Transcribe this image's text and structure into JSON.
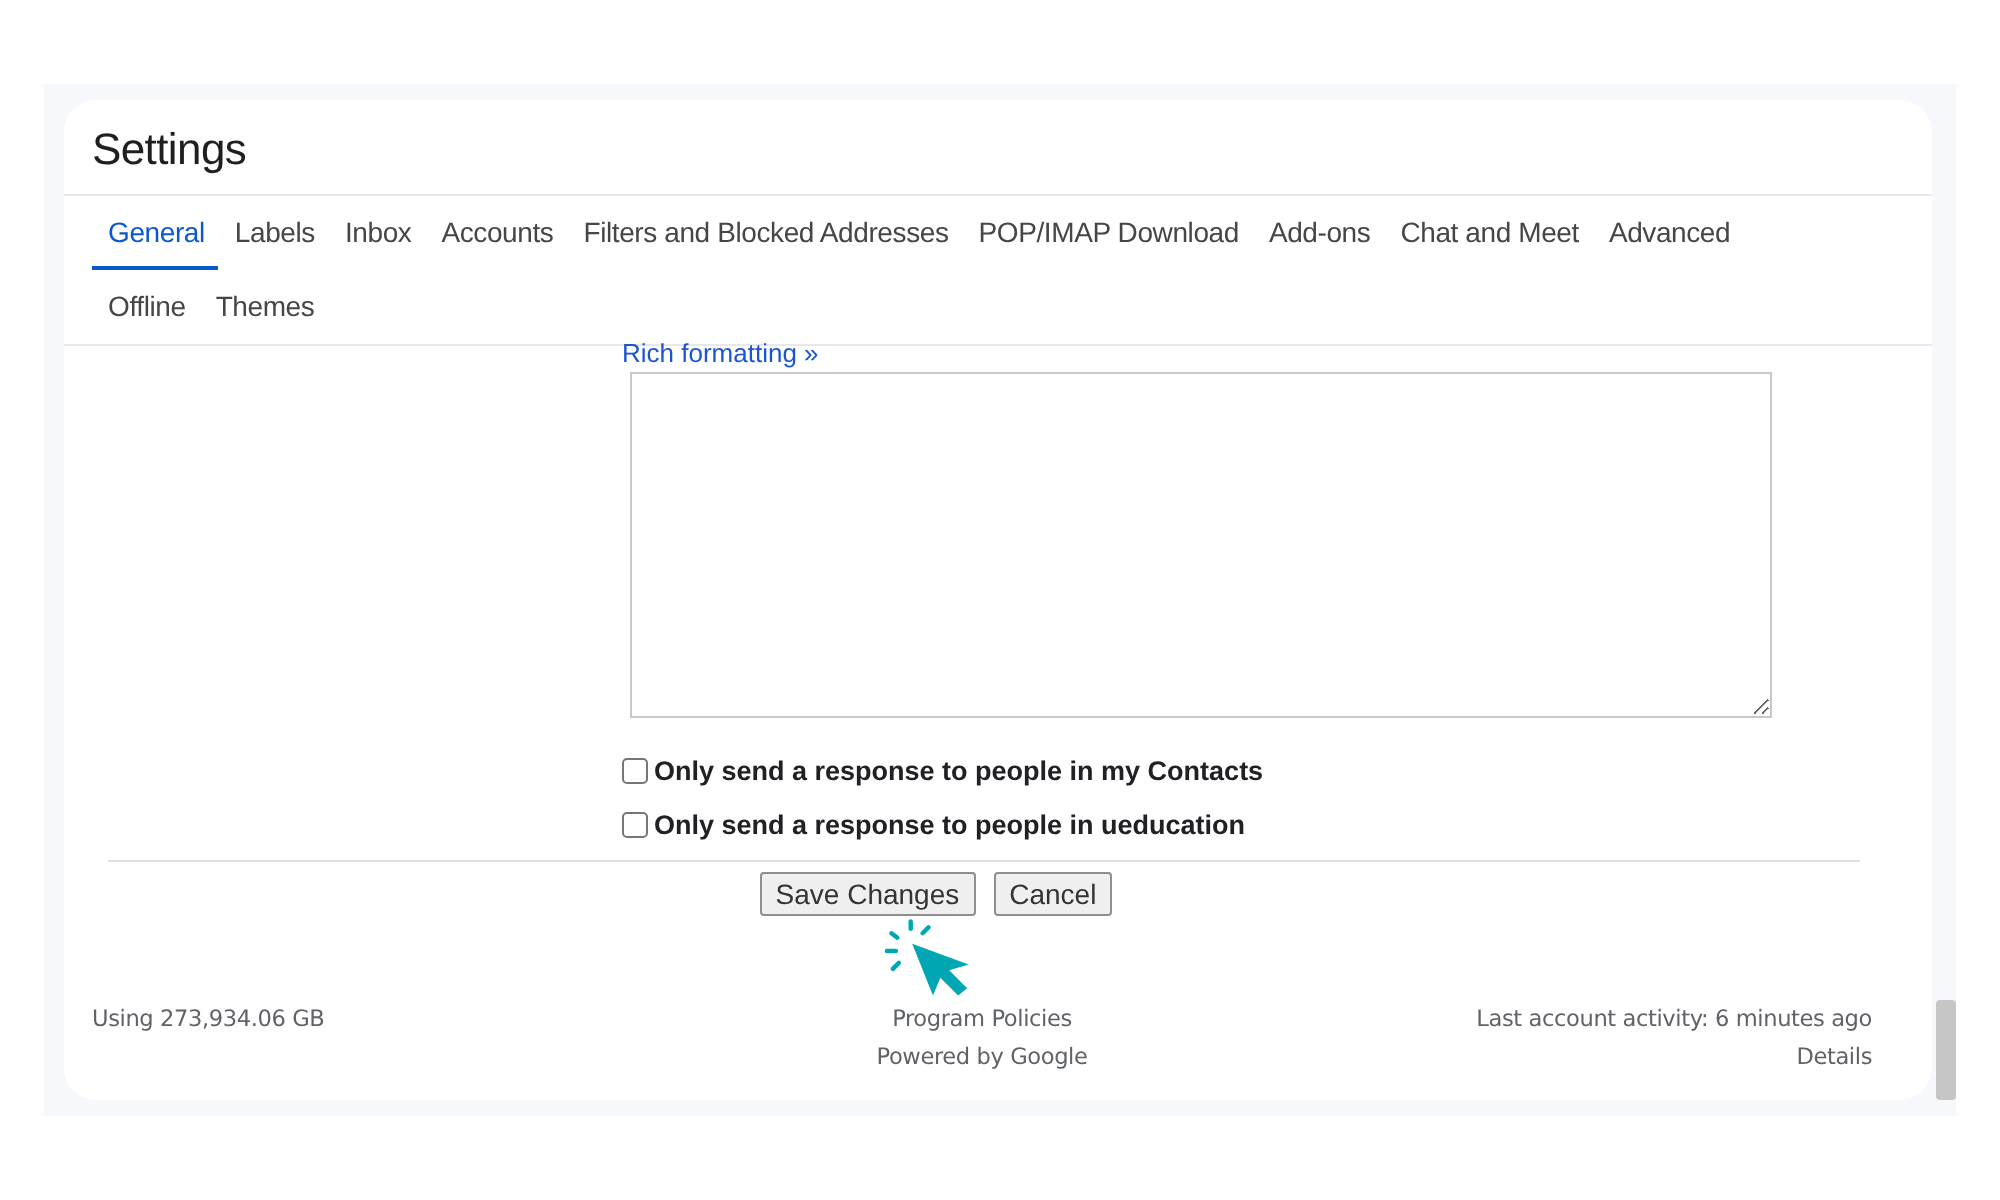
{
  "title": "Settings",
  "tabs": [
    {
      "label": "General",
      "selected": true
    },
    {
      "label": "Labels",
      "selected": false
    },
    {
      "label": "Inbox",
      "selected": false
    },
    {
      "label": "Accounts",
      "selected": false
    },
    {
      "label": "Filters and Blocked Addresses",
      "selected": false
    },
    {
      "label": "POP/IMAP Download",
      "selected": false
    },
    {
      "label": "Add-ons",
      "selected": false
    },
    {
      "label": "Chat and Meet",
      "selected": false
    },
    {
      "label": "Advanced",
      "selected": false
    },
    {
      "label": "Offline",
      "selected": false
    },
    {
      "label": "Themes",
      "selected": false
    }
  ],
  "reply": {
    "link": "Rich formatting »"
  },
  "options": [
    {
      "label": "Only send a response to people in my Contacts",
      "checked": false
    },
    {
      "label": "Only send a response to people in ueducation",
      "checked": false
    }
  ],
  "buttons": [
    "Save Changes",
    "Cancel"
  ],
  "footer": {
    "storage": "Using 273,934.06 GB",
    "links": [
      "Program Policies",
      "Powered by Google"
    ],
    "activity": "Last account activity: 6 minutes ago",
    "details": "Details"
  }
}
